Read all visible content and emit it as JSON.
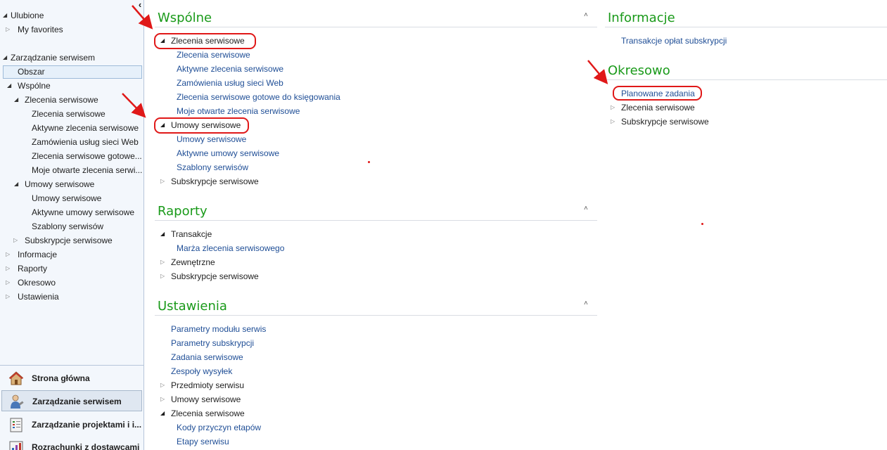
{
  "nav": {
    "tree": {
      "favorites_group": "Ulubione",
      "my_favorites": "My favorites",
      "module_group": "Zarządzanie serwisem",
      "area": "Obszar",
      "common": "Wspólne",
      "service_orders_group": "Zlecenia serwisowe",
      "service_orders_items": [
        "Zlecenia serwisowe",
        "Aktywne zlecenia serwisowe",
        "Zamówienia usług sieci Web",
        "Zlecenia serwisowe gotowe...",
        "Moje otwarte zlecenia serwi..."
      ],
      "agreements_group": "Umowy serwisowe",
      "agreements_items": [
        "Umowy serwisowe",
        "Aktywne umowy serwisowe",
        "Szablony serwisów"
      ],
      "subscriptions": "Subskrypcje serwisowe",
      "info": "Informacje",
      "reports": "Raporty",
      "periodic": "Okresowo",
      "settings": "Ustawienia"
    },
    "buttons": [
      "Strona główna",
      "Zarządzanie serwisem",
      "Zarządzanie projektami i i...",
      "Rozrachunki z dostawcami"
    ]
  },
  "common_section": {
    "title": "Wspólne",
    "service_orders_group": "Zlecenia serwisowe",
    "service_orders_links": [
      "Zlecenia serwisowe",
      "Aktywne zlecenia serwisowe",
      "Zamówienia usług sieci Web",
      "Zlecenia serwisowe gotowe do księgowania",
      "Moje otwarte zlecenia serwisowe"
    ],
    "agreements_group": "Umowy serwisowe",
    "agreements_links": [
      "Umowy serwisowe",
      "Aktywne umowy serwisowe",
      "Szablony serwisów"
    ],
    "subscriptions_group": "Subskrypcje serwisowe"
  },
  "reports_section": {
    "title": "Raporty",
    "transactions_group": "Transakcje",
    "transactions_links": [
      "Marża zlecenia serwisowego"
    ],
    "external_group": "Zewnętrzne",
    "subscriptions_group": "Subskrypcje serwisowe"
  },
  "settings_section": {
    "title": "Ustawienia",
    "links": [
      "Parametry modułu serwis",
      "Parametry subskrypcji",
      "Zadania serwisowe",
      "Zespoły wysyłek"
    ],
    "groups": [
      "Przedmioty serwisu",
      "Umowy serwisowe"
    ],
    "service_orders_group": "Zlecenia serwisowe",
    "service_orders_links": [
      "Kody przyczyn etapów",
      "Etapy serwisu"
    ]
  },
  "info_section": {
    "title": "Informacje",
    "links": [
      "Transakcje opłat subskrypcji"
    ]
  },
  "periodic_section": {
    "title": "Okresowo",
    "links": [
      "Planowane zadania"
    ],
    "groups": [
      "Zlecenia serwisowe",
      "Subskrypcje serwisowe"
    ]
  },
  "colors": {
    "section_title": "#1a9a1a",
    "link": "#1f4e96",
    "annotation": "#e01818"
  }
}
